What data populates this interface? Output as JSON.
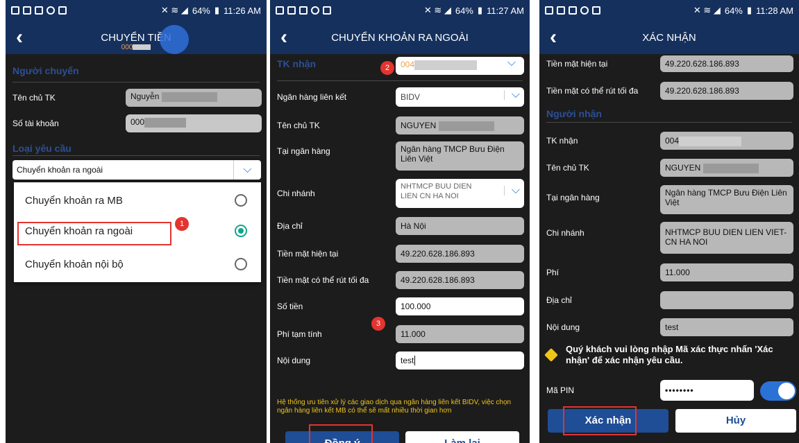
{
  "status": {
    "battery": "64%",
    "time1": "11:26 AM",
    "time2": "11:27 AM",
    "time3": "11:28 AM"
  },
  "screen1": {
    "title": "CHUYỂN TIỀN",
    "subtitle": "000",
    "sender_section": "Người chuyển",
    "owner_label": "Tên chủ TK",
    "owner_value": "Nguyễn",
    "account_label": "Số tài khoản",
    "account_value": "000",
    "request_section": "Loại yêu cầu",
    "request_selected": "Chuyển khoản ra ngoài",
    "options": [
      "Chuyển khoản ra MB",
      "Chuyển khoản ra ngoài",
      "Chuyển khoản nội bộ"
    ],
    "selected_index": 1,
    "badge": "1"
  },
  "screen2": {
    "title": "CHUYỂN KHOẢN RA NGOÀI",
    "receiver_label": "TK nhận",
    "receiver_value": "004",
    "badge2": "2",
    "bank_label": "Ngân hàng liên kết",
    "bank_value": "BIDV",
    "owner_label": "Tên chủ TK",
    "owner_value": "NGUYEN",
    "at_bank_label": "Tại ngân hàng",
    "at_bank_value": "Ngân hàng TMCP Bưu Điện Liên Việt",
    "branch_label": "Chi nhánh",
    "branch_value": "NHTMCP BUU DIEN LIEN CN HA NOI",
    "address_label": "Địa chỉ",
    "address_value": "Hà Nội",
    "cash_label": "Tiền mặt hiện tại",
    "cash_value": "49.220.628.186.893",
    "max_label": "Tiền mặt có thể rút tối đa",
    "max_value": "49.220.628.186.893",
    "amount_label": "Số tiền",
    "amount_value": "100.000",
    "badge3": "3",
    "fee_label": "Phí tạm tính",
    "fee_value": "11.000",
    "content_label": "Nội dung",
    "content_value": "test",
    "notice": "Hệ thống ưu tiên xử lý các giao dịch qua ngân hàng liên kết BIDV, việc chọn ngân hàng liên kết MB có thể sẽ mất nhiều thời gian hơn",
    "agree_button": "Đồng ý",
    "reset_button": "Làm lại"
  },
  "screen3": {
    "title": "XÁC NHẬN",
    "cash_label": "Tiền mặt hiện tại",
    "cash_value": "49.220.628.186.893",
    "max_label": "Tiền mặt có thể rút tối đa",
    "max_value": "49.220.628.186.893",
    "receiver_section": "Người nhận",
    "receiver_label": "TK nhận",
    "receiver_value": "004",
    "owner_label": "Tên chủ TK",
    "owner_value": "NGUYEN",
    "at_bank_label": "Tại ngân hàng",
    "at_bank_value": "Ngân hàng TMCP Bưu Điện Liên Việt",
    "branch_label": "Chi nhánh",
    "branch_value": "NHTMCP BUU DIEN LIEN VIET-CN HA NOI",
    "fee_label": "Phí",
    "fee_value": "11.000",
    "address_label": "Địa chỉ",
    "address_value": "",
    "content_label": "Nội dung",
    "content_value": "test",
    "notice": "Quý khách vui lòng nhập Mã xác thực nhấn 'Xác nhận' để xác nhận yêu cầu.",
    "pin_label": "Mã PIN",
    "pin_value": "••••••••",
    "confirm_button": "Xác nhận",
    "cancel_button": "Hủy"
  },
  "colors": {
    "header": "#15305d",
    "accent": "#2a72d6",
    "highlight": "#e3342f",
    "notice": "#f0c419"
  }
}
